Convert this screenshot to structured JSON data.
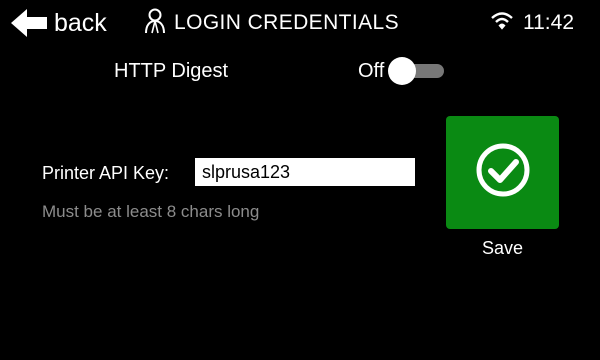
{
  "header": {
    "back_label": "back",
    "back_icon": "arrow-left-icon",
    "title_icon": "user-icon",
    "title": "LOGIN CREDENTIALS",
    "wifi_icon": "wifi-icon",
    "time": "11:42"
  },
  "digest": {
    "label": "HTTP Digest",
    "state_label": "Off",
    "enabled": false
  },
  "api_key": {
    "label": "Printer API Key:",
    "value": "slprusa123",
    "hint": "Must be at least 8 chars long"
  },
  "save": {
    "label": "Save",
    "icon": "check-circle-icon",
    "color": "#0a8a13"
  }
}
